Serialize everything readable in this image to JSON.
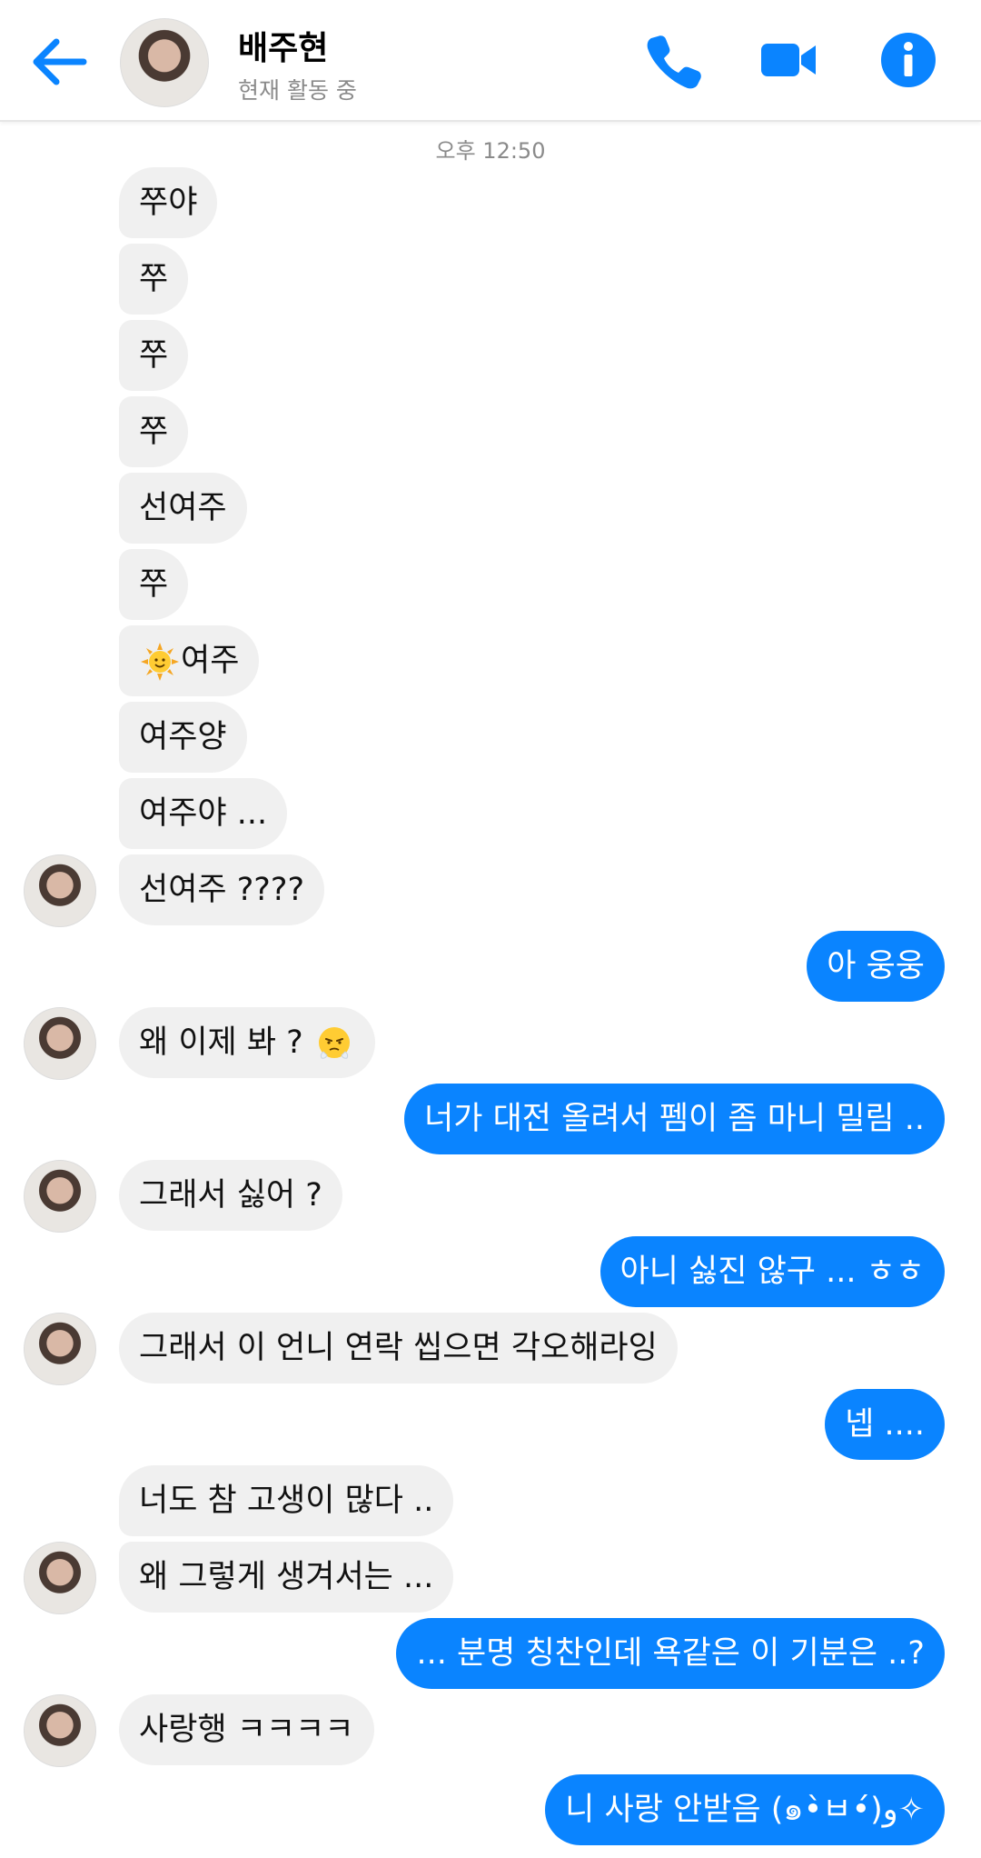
{
  "header": {
    "name": "배주현",
    "status": "현재 활동 중"
  },
  "timestamp": "오후 12:50",
  "colors": {
    "accent": "#0a84ff",
    "received_bubble": "#f0f0f0"
  },
  "messages": [
    {
      "from": "them",
      "text": "쭈야"
    },
    {
      "from": "them",
      "text": "쭈"
    },
    {
      "from": "them",
      "text": "쭈"
    },
    {
      "from": "them",
      "text": "쭈"
    },
    {
      "from": "them",
      "text": "선여주"
    },
    {
      "from": "them",
      "text": "쭈"
    },
    {
      "from": "them",
      "emoji": "sun-face-emoji",
      "text": "여주"
    },
    {
      "from": "them",
      "text": "여주양"
    },
    {
      "from": "them",
      "text": "여주야 ..."
    },
    {
      "from": "them",
      "text": "선여주 ????"
    },
    {
      "from": "me",
      "text": "아 웅웅"
    },
    {
      "from": "them",
      "text": "왜 이제 봐 ?",
      "emoji_after": "huffing-face-emoji"
    },
    {
      "from": "me",
      "text": "너가 대전 올려서 펨이 좀 마니 밀림 .."
    },
    {
      "from": "them",
      "text": "그래서 싫어 ?"
    },
    {
      "from": "me",
      "text": "아니 싫진 않구 ... ㅎㅎ"
    },
    {
      "from": "them",
      "text": "그래서 이 언니 연락 씹으면 각오해라잉"
    },
    {
      "from": "me",
      "text": "넵 ...."
    },
    {
      "from": "them",
      "text": "너도 참 고생이 많다 .."
    },
    {
      "from": "them",
      "text": "왜 그렇게 생겨서는 ..."
    },
    {
      "from": "me",
      "text": "... 분명 칭찬인데 욕같은 이 기분은 ..?"
    },
    {
      "from": "them",
      "text": "사랑행 ㅋㅋㅋㅋ"
    },
    {
      "from": "me",
      "text": "니 사랑 안받음 (๑•̀ㅂ•́)و✧"
    }
  ]
}
